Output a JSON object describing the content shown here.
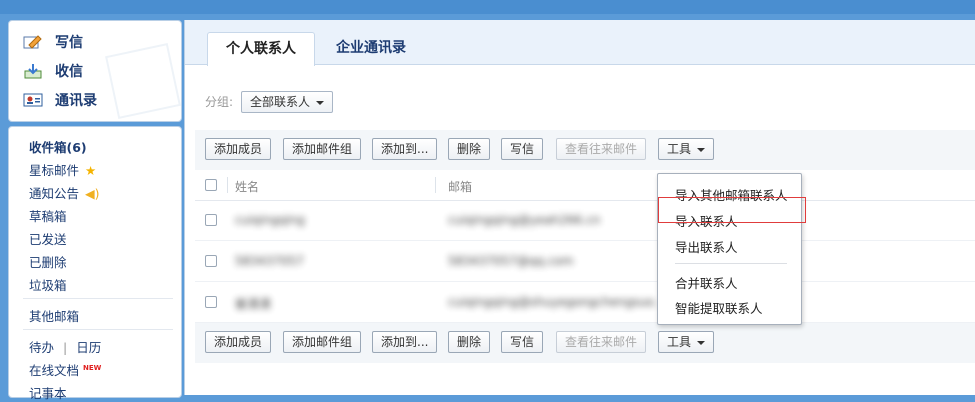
{
  "sidebar": {
    "top_nav": [
      {
        "label": "写信",
        "icon": "pencil-icon"
      },
      {
        "label": "收信",
        "icon": "inbox-download-icon"
      },
      {
        "label": "通讯录",
        "icon": "contact-card-icon"
      }
    ],
    "folders": {
      "inbox": "收件箱(6)",
      "starred": "星标邮件",
      "notice": "通知公告",
      "drafts": "草稿箱",
      "sent": "已发送",
      "deleted": "已删除",
      "trash": "垃圾箱",
      "other_mail": "其他邮箱",
      "todo": "待办",
      "divider": "|",
      "calendar": "日历",
      "online_docs": "在线文档",
      "new_badge": "NEW",
      "more": "记事本"
    },
    "star_color": "#f5b400",
    "speaker_color": "#f0b020"
  },
  "tabs": [
    {
      "label": "个人联系人",
      "active": true
    },
    {
      "label": "企业通讯录",
      "active": false
    }
  ],
  "filter": {
    "label": "分组:",
    "value": "全部联系人"
  },
  "toolbar": {
    "add_member": "添加成员",
    "add_group": "添加邮件组",
    "add_to": "添加到...",
    "delete": "删除",
    "compose": "写信",
    "view_mails": "查看往来邮件",
    "tools": "工具"
  },
  "table": {
    "col_name": "姓名",
    "col_email": "邮箱",
    "rows": [
      {
        "name": "cuiqingqing",
        "email": "cuiqingqing@yeah266.cn"
      },
      {
        "name": "583437057",
        "email": "583437057@qq.com"
      },
      {
        "name": "崔清清",
        "email": "cuiqingqing@shuyegongchengsuo.cn.xmail.cn"
      }
    ]
  },
  "dropdown": {
    "items": [
      "导入其他邮箱联系人",
      "导入联系人",
      "导出联系人",
      "合并联系人",
      "智能提取联系人"
    ]
  },
  "colors": {
    "accent_blue": "#5b9bd8",
    "link_blue": "#1d3c72",
    "highlight_red": "#e03c3c"
  }
}
